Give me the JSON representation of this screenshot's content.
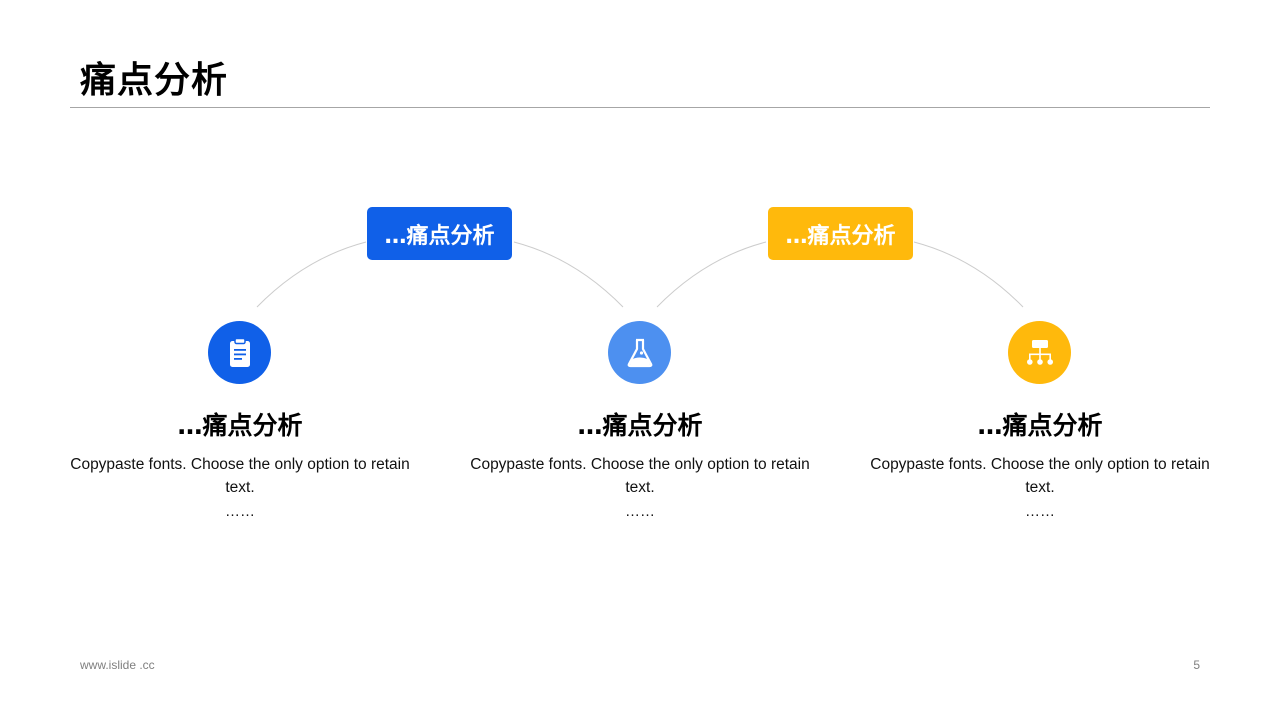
{
  "slide": {
    "title": "痛点分析",
    "footer_url": "www.islide .cc",
    "page_number": "5"
  },
  "colors": {
    "blue": "#1060e8",
    "light_blue": "#4d90f0",
    "yellow": "#ffb90c",
    "connector": "#cccccc",
    "rule": "#a6a6a6"
  },
  "pills": [
    {
      "label": "…痛点分析",
      "color": "#1060e8"
    },
    {
      "label": "…痛点分析",
      "color": "#ffb90c"
    }
  ],
  "cards": [
    {
      "icon": "clipboard-icon",
      "icon_color": "#1060e8",
      "heading": "…痛点分析",
      "body": "Copypaste fonts. Choose the only option to retain text.",
      "ellipsis": "……"
    },
    {
      "icon": "flask-icon",
      "icon_color": "#4d90f0",
      "heading": "…痛点分析",
      "body": "Copypaste fonts. Choose the only option to retain text.",
      "ellipsis": "……"
    },
    {
      "icon": "hierarchy-icon",
      "icon_color": "#ffb90c",
      "heading": "…痛点分析",
      "body": "Copypaste fonts. Choose the only option to retain text.",
      "ellipsis": "……"
    }
  ]
}
